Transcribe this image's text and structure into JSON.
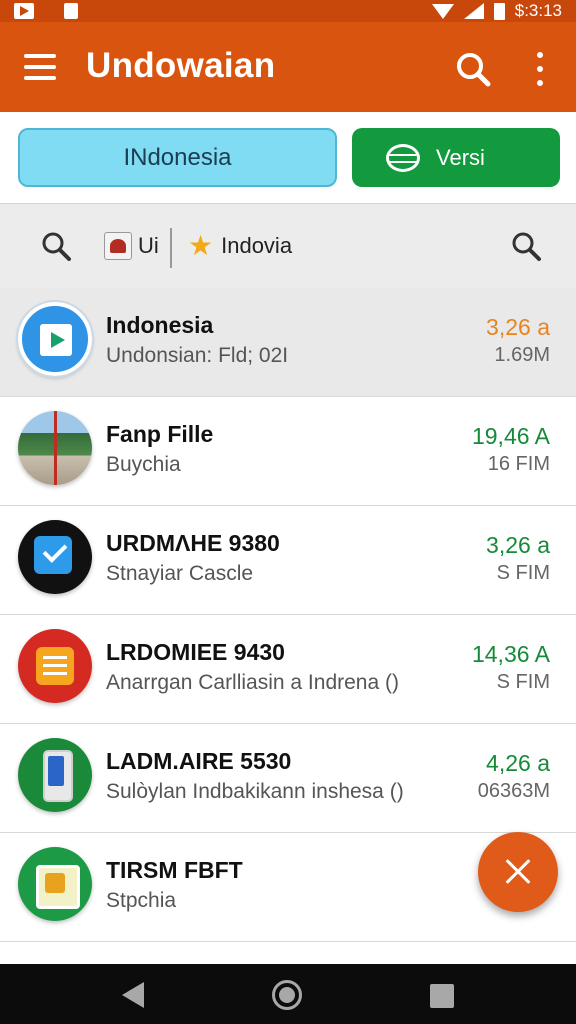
{
  "status_bar": {
    "time": "$:3:13"
  },
  "app_bar": {
    "title": "Undowaian"
  },
  "tabs": [
    {
      "label": "INdonesia",
      "color": "#7fdcf2"
    },
    {
      "label": "Versi",
      "color": "#139a3f"
    }
  ],
  "filter": {
    "chip_ui_label": "Ui",
    "chip_indovia_label": "Indovia"
  },
  "apps": [
    {
      "title": "Indonesia",
      "subtitle": "Undonsian: Fld; 02I",
      "rating": "3,26 a",
      "size": "1.69M",
      "rating_color": "#e8841e",
      "icon": "play-icon"
    },
    {
      "title": "Fanp Fille",
      "subtitle": "Buychia",
      "rating": "19,46 A",
      "size": "16 FIM",
      "rating_color": "#168a3a",
      "icon": "photo-icon"
    },
    {
      "title": "URDMΛHE 9380",
      "subtitle": "Stnayiar Cascle",
      "rating": "3,26 a",
      "size": "S FIM",
      "rating_color": "#168a3a",
      "icon": "checkmark-icon"
    },
    {
      "title": "LRDOMIEE 9430",
      "subtitle": "Anarrgan Carlliasin a Indrena ()",
      "rating": "14,36 A",
      "size": "S FIM",
      "rating_color": "#168a3a",
      "icon": "list-icon"
    },
    {
      "title": "LADM.AIRE 5530",
      "subtitle": "Sulòylan Indbakikann inshesa ()",
      "rating": "4,26 a",
      "size": "06363M",
      "rating_color": "#168a3a",
      "icon": "phone-icon"
    },
    {
      "title": "TIRSM FBFT",
      "subtitle": "Stpchia",
      "rating": "",
      "size": "",
      "rating_color": "#168a3a",
      "icon": "frame-icon"
    }
  ],
  "colors": {
    "app_bar": "#d9540f",
    "status_bar": "#c8470b",
    "fab": "#e05a1a",
    "accent_green": "#168a3a",
    "accent_orange": "#e8841e"
  }
}
